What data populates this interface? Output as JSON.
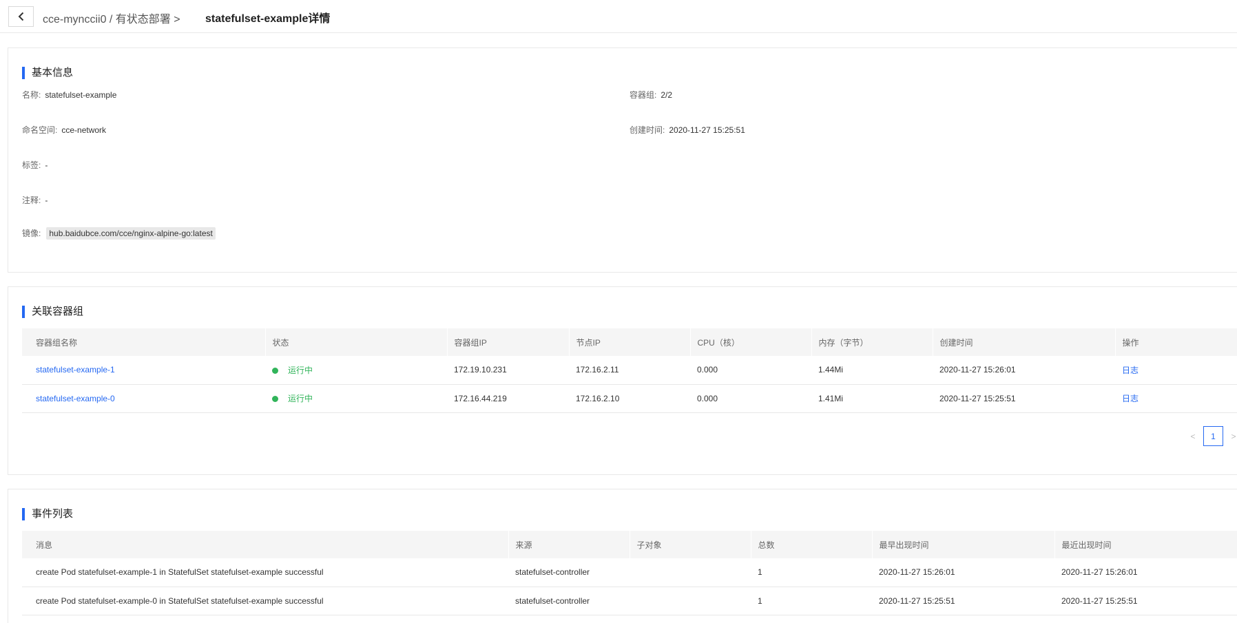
{
  "header": {
    "breadcrumb": "cce-mynccii0 / 有状态部署 >",
    "title": "statefulset-example详情"
  },
  "basic_info": {
    "section_title": "基本信息",
    "name_label": "名称:",
    "name_value": "statefulset-example",
    "pods_label": "容器组:",
    "pods_value": "2/2",
    "namespace_label": "命名空间:",
    "namespace_value": "cce-network",
    "created_label": "创建时间:",
    "created_value": "2020-11-27 15:25:51",
    "labels_label": "标签:",
    "labels_value": "-",
    "annotations_label": "注释:",
    "annotations_value": "-",
    "image_label": "镜像:",
    "image_value": "hub.baidubce.com/cce/nginx-alpine-go:latest"
  },
  "pods": {
    "section_title": "关联容器组",
    "columns": [
      "容器组名称",
      "状态",
      "容器组IP",
      "节点IP",
      "CPU（核）",
      "内存（字节）",
      "创建时间",
      "操作"
    ],
    "rows": [
      {
        "name": "statefulset-example-1",
        "status": "运行中",
        "pod_ip": "172.19.10.231",
        "node_ip": "172.16.2.11",
        "cpu": "0.000",
        "memory": "1.44Mi",
        "created": "2020-11-27 15:26:01",
        "action": "日志"
      },
      {
        "name": "statefulset-example-0",
        "status": "运行中",
        "pod_ip": "172.16.44.219",
        "node_ip": "172.16.2.10",
        "cpu": "0.000",
        "memory": "1.41Mi",
        "created": "2020-11-27 15:25:51",
        "action": "日志"
      }
    ],
    "pagination": {
      "prev": "<",
      "page": "1",
      "next": ">"
    }
  },
  "events": {
    "section_title": "事件列表",
    "columns": [
      "消息",
      "来源",
      "子对象",
      "总数",
      "最早出现时间",
      "最近出现时间"
    ],
    "rows": [
      {
        "message": "create Pod statefulset-example-1 in StatefulSet statefulset-example successful",
        "source": "statefulset-controller",
        "subobject": "",
        "count": "1",
        "first_seen": "2020-11-27 15:26:01",
        "last_seen": "2020-11-27 15:26:01"
      },
      {
        "message": "create Pod statefulset-example-0 in StatefulSet statefulset-example successful",
        "source": "statefulset-controller",
        "subobject": "",
        "count": "1",
        "first_seen": "2020-11-27 15:25:51",
        "last_seen": "2020-11-27 15:25:51"
      }
    ]
  },
  "colors": {
    "accent": "#2468f2",
    "running": "#31b45a"
  },
  "icons": {
    "back": "chevron-left-icon",
    "status": "status-dot-icon"
  }
}
